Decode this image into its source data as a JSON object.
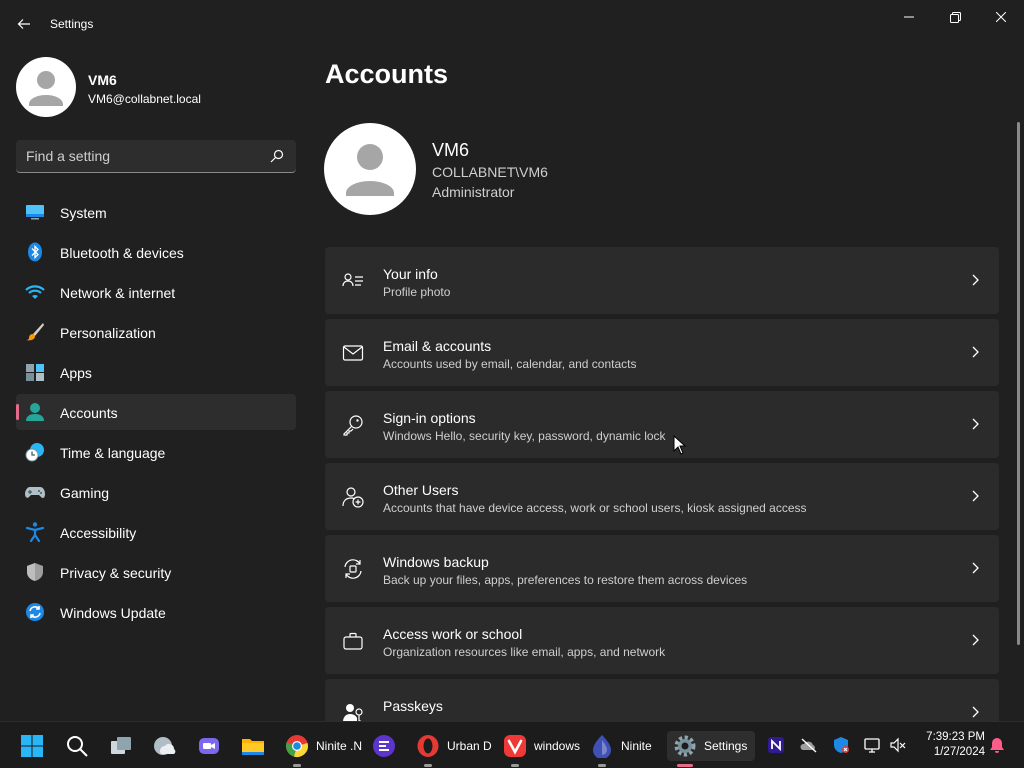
{
  "app": {
    "title": "Settings"
  },
  "profile": {
    "name": "VM6",
    "email": "VM6@collabnet.local"
  },
  "search": {
    "placeholder": "Find a setting",
    "value": ""
  },
  "sidebar": {
    "items": [
      {
        "label": "System",
        "icon": "monitor-icon",
        "active": false
      },
      {
        "label": "Bluetooth & devices",
        "icon": "bluetooth-icon",
        "active": false
      },
      {
        "label": "Network & internet",
        "icon": "wifi-icon",
        "active": false
      },
      {
        "label": "Personalization",
        "icon": "paintbrush-icon",
        "active": false
      },
      {
        "label": "Apps",
        "icon": "apps-icon",
        "active": false
      },
      {
        "label": "Accounts",
        "icon": "person-icon",
        "active": true
      },
      {
        "label": "Time & language",
        "icon": "globe-clock-icon",
        "active": false
      },
      {
        "label": "Gaming",
        "icon": "gamepad-icon",
        "active": false
      },
      {
        "label": "Accessibility",
        "icon": "accessibility-icon",
        "active": false
      },
      {
        "label": "Privacy & security",
        "icon": "shield-icon",
        "active": false
      },
      {
        "label": "Windows Update",
        "icon": "update-icon",
        "active": false
      }
    ]
  },
  "main": {
    "title": "Accounts",
    "account": {
      "name": "VM6",
      "domain": "COLLABNET\\VM6",
      "role": "Administrator"
    },
    "cards": [
      {
        "title": "Your info",
        "desc": "Profile photo",
        "icon": "person-details-icon"
      },
      {
        "title": "Email & accounts",
        "desc": "Accounts used by email, calendar, and contacts",
        "icon": "mail-icon"
      },
      {
        "title": "Sign-in options",
        "desc": "Windows Hello, security key, password, dynamic lock",
        "icon": "key-icon"
      },
      {
        "title": "Other Users",
        "desc": "Accounts that have device access, work or school users, kiosk assigned access",
        "icon": "add-user-icon"
      },
      {
        "title": "Windows backup",
        "desc": "Back up your files, apps, preferences to restore them across devices",
        "icon": "backup-icon"
      },
      {
        "title": "Access work or school",
        "desc": "Organization resources like email, apps, and network",
        "icon": "briefcase-icon"
      },
      {
        "title": "Passkeys",
        "desc": "",
        "icon": "passkey-icon"
      }
    ]
  },
  "taskbar": {
    "apps": [
      {
        "label": "Ninite .N",
        "icon": "chrome-icon"
      },
      {
        "label": "Urban D",
        "icon": "opera-icon"
      },
      {
        "label": "windows",
        "icon": "vivaldi-icon"
      },
      {
        "label": "Ninite",
        "icon": "ninite-icon"
      },
      {
        "label": "Settings",
        "icon": "gear-icon"
      }
    ],
    "time": "7:39:23 PM",
    "date": "1/27/2024"
  },
  "colors": {
    "background": "#202020",
    "card": "#2b2b2b",
    "accent_selected": "#e56b8b",
    "taskbar": "#1c1c1c"
  }
}
